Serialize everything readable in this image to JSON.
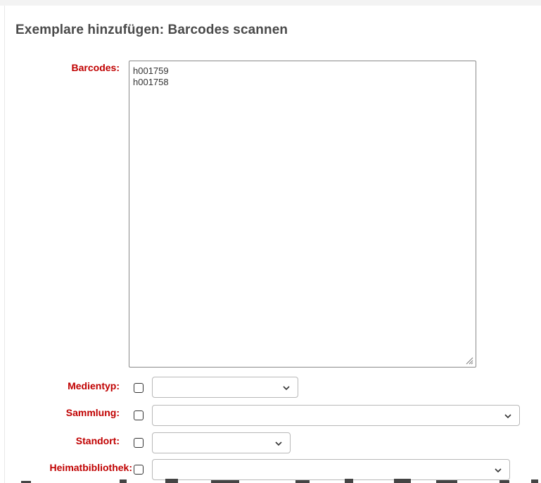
{
  "form": {
    "title": "Exemplare hinzufügen: Barcodes scannen",
    "barcodes_label": "Barcodes:",
    "barcodes": [
      "h001759",
      "h001758"
    ],
    "fields": [
      {
        "label": "Medientyp:",
        "selected": ""
      },
      {
        "label": "Sammlung:",
        "selected": ""
      },
      {
        "label": "Standort:",
        "selected": ""
      },
      {
        "label": "Heimatbibliothek:",
        "selected": ""
      }
    ]
  },
  "colors": {
    "label": "#c00000",
    "title": "#4a4a4a"
  }
}
